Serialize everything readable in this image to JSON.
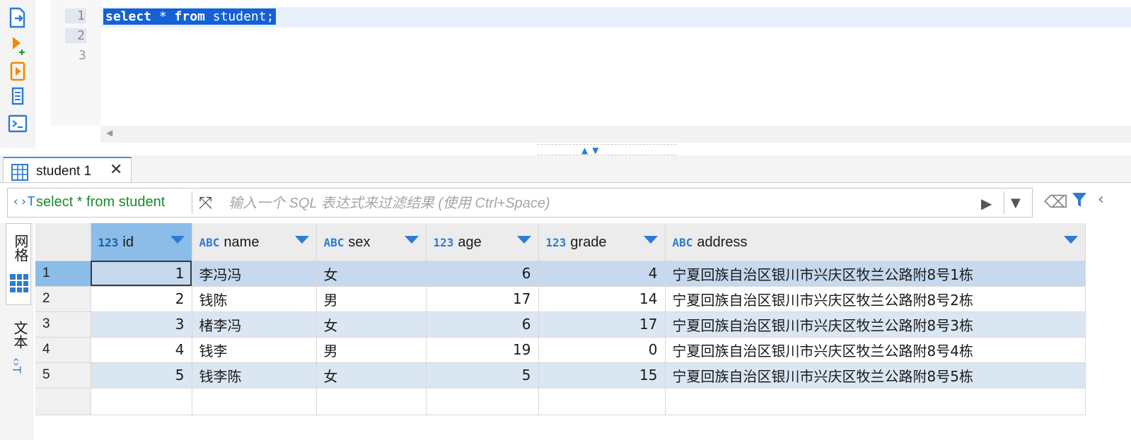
{
  "editor": {
    "line_numbers": [
      "1",
      "2",
      "3"
    ],
    "code_keyword1": "select",
    "code_mid": " * ",
    "code_keyword2": "from",
    "code_rest": " student;"
  },
  "toolbar_icons": [
    "execute-script-icon",
    "execute-query-icon",
    "execute-statement-icon",
    "explain-plan-icon",
    "console-icon"
  ],
  "tab": {
    "label": "student 1",
    "icon": "table-icon"
  },
  "filter": {
    "query": "select * from student",
    "placeholder": "输入一个 SQL 表达式来过滤结果 (使用 Ctrl+Space)"
  },
  "side_tabs": {
    "grid": "网格",
    "text": "文本"
  },
  "columns": [
    {
      "type": "123",
      "name": "id"
    },
    {
      "type": "ABC",
      "name": "name"
    },
    {
      "type": "ABC",
      "name": "sex"
    },
    {
      "type": "123",
      "name": "age"
    },
    {
      "type": "123",
      "name": "grade"
    },
    {
      "type": "ABC",
      "name": "address"
    }
  ],
  "rows": [
    {
      "rn": "1",
      "id": "1",
      "name": "李冯冯",
      "sex": "女",
      "age": "6",
      "grade": "4",
      "address": "宁夏回族自治区银川市兴庆区牧兰公路附8号1栋"
    },
    {
      "rn": "2",
      "id": "2",
      "name": "钱陈",
      "sex": "男",
      "age": "17",
      "grade": "14",
      "address": "宁夏回族自治区银川市兴庆区牧兰公路附8号2栋"
    },
    {
      "rn": "3",
      "id": "3",
      "name": "楮李冯",
      "sex": "女",
      "age": "6",
      "grade": "17",
      "address": "宁夏回族自治区银川市兴庆区牧兰公路附8号3栋"
    },
    {
      "rn": "4",
      "id": "4",
      "name": "钱李",
      "sex": "男",
      "age": "19",
      "grade": "0",
      "address": "宁夏回族自治区银川市兴庆区牧兰公路附8号4栋"
    },
    {
      "rn": "5",
      "id": "5",
      "name": "钱李陈",
      "sex": "女",
      "age": "5",
      "grade": "15",
      "address": "宁夏回族自治区银川市兴庆区牧兰公路附8号5栋"
    }
  ],
  "colors": {
    "accent": "#2b7cd3",
    "selection": "#1560d4",
    "query_text": "#1a8a2a"
  }
}
